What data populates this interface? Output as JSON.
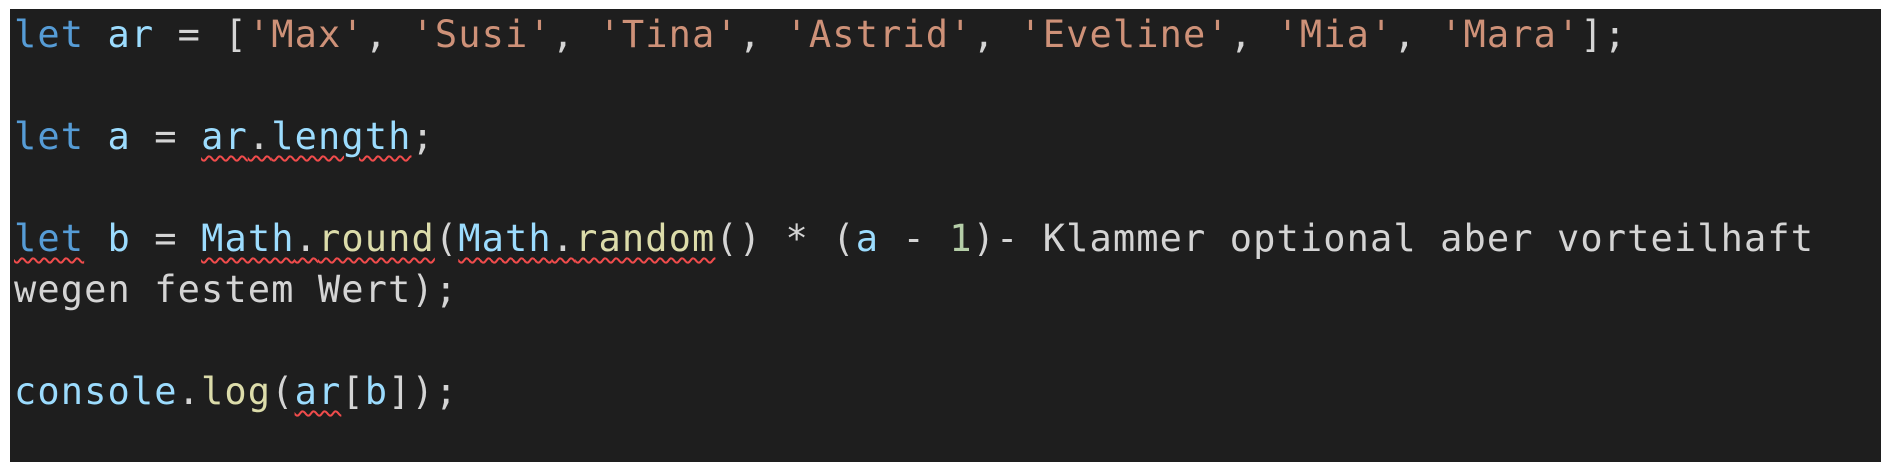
{
  "editor": {
    "lines": [
      {
        "tokens": [
          {
            "text": "let",
            "kind": "keyword"
          },
          {
            "text": " "
          },
          {
            "text": "ar",
            "kind": "variable"
          },
          {
            "text": " = ["
          },
          {
            "text": "'Max'",
            "kind": "string"
          },
          {
            "text": ", "
          },
          {
            "text": "'Susi'",
            "kind": "string"
          },
          {
            "text": ", "
          },
          {
            "text": "'Tina'",
            "kind": "string"
          },
          {
            "text": ", "
          },
          {
            "text": "'Astrid'",
            "kind": "string"
          },
          {
            "text": ", "
          },
          {
            "text": "'Eveline'",
            "kind": "string"
          },
          {
            "text": ", "
          },
          {
            "text": "'Mia'",
            "kind": "string"
          },
          {
            "text": ", "
          },
          {
            "text": "'Mara'",
            "kind": "string"
          },
          {
            "text": "];"
          }
        ]
      },
      {
        "tokens": []
      },
      {
        "tokens": [
          {
            "text": "let",
            "kind": "keyword"
          },
          {
            "text": " "
          },
          {
            "text": "a",
            "kind": "variable"
          },
          {
            "text": " = "
          },
          {
            "text": "ar",
            "kind": "variable",
            "squiggle": true
          },
          {
            "text": ".",
            "squiggle": true
          },
          {
            "text": "length",
            "kind": "variable",
            "squiggle": true
          },
          {
            "text": ";"
          }
        ]
      },
      {
        "tokens": []
      },
      {
        "tokens": [
          {
            "text": "let",
            "kind": "keyword",
            "squiggle": true
          },
          {
            "text": " "
          },
          {
            "text": "b",
            "kind": "variable"
          },
          {
            "text": " = "
          },
          {
            "text": "Math",
            "kind": "variable",
            "squiggle": true
          },
          {
            "text": ".",
            "squiggle": true
          },
          {
            "text": "round",
            "kind": "function",
            "squiggle": true
          },
          {
            "text": "("
          },
          {
            "text": "Math",
            "kind": "variable",
            "squiggle": true
          },
          {
            "text": ".",
            "squiggle": true
          },
          {
            "text": "random",
            "kind": "function",
            "squiggle": true
          },
          {
            "text": "() * ("
          },
          {
            "text": "a",
            "kind": "variable"
          },
          {
            "text": " - "
          },
          {
            "text": "1",
            "kind": "number"
          },
          {
            "text": ")- Klammer optional aber vorteilhaft"
          }
        ]
      },
      {
        "tokens": [
          {
            "text": "wegen festem Wert);"
          }
        ]
      },
      {
        "tokens": []
      },
      {
        "tokens": [
          {
            "text": "console",
            "kind": "variable"
          },
          {
            "text": "."
          },
          {
            "text": "log",
            "kind": "function"
          },
          {
            "text": "("
          },
          {
            "text": "ar",
            "kind": "variable",
            "squiggle": true
          },
          {
            "text": "["
          },
          {
            "text": "b",
            "kind": "variable"
          },
          {
            "text": "]);"
          }
        ]
      }
    ],
    "colors": {
      "background": "#1e1e1e",
      "keyword": "#569cd6",
      "variable": "#9cdcfe",
      "string": "#ce9178",
      "function": "#dcdcaa",
      "number": "#b5cea8",
      "plain": "#d4d4d4",
      "error_squiggle": "#f14c4c"
    }
  }
}
